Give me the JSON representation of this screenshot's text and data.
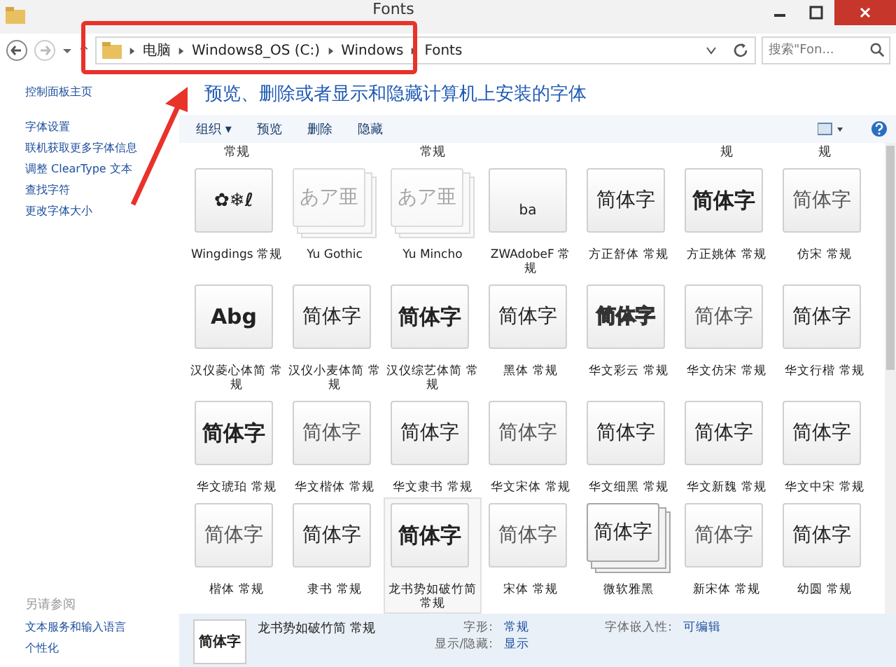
{
  "window": {
    "title": "Fonts"
  },
  "address": {
    "segments": [
      "电脑",
      "Windows8_OS (C:)",
      "Windows",
      "Fonts"
    ],
    "search_placeholder": "搜索\"Fon..."
  },
  "sidebar": {
    "home": "控制面板主页",
    "links": [
      "字体设置",
      "联机获取更多字体信息",
      "调整 ClearType 文本",
      "查找字符",
      "更改字体大小"
    ],
    "see_also_title": "另请参阅",
    "see_also": [
      "文本服务和输入语言",
      "个性化"
    ]
  },
  "heading": "预览、删除或者显示和隐藏计算机上安装的字体",
  "toolbar": {
    "organize": "组织 ▾",
    "buttons": [
      "预览",
      "删除",
      "隐藏"
    ]
  },
  "top_row": [
    {
      "kind": "label",
      "label": "常规"
    },
    {
      "kind": "blank"
    },
    {
      "kind": "label",
      "label": "常规"
    },
    {
      "kind": "blank"
    },
    {
      "kind": "blank"
    },
    {
      "kind": "label",
      "label": "规"
    },
    {
      "kind": "label",
      "label": "规"
    }
  ],
  "fonts": [
    {
      "preview": "✿❄ℓ",
      "kind": "symbol",
      "name": "Wingdings 常规",
      "hidden": false,
      "stacked": false,
      "selected": false
    },
    {
      "preview": "あア亜",
      "kind": "sans",
      "name": "Yu Gothic",
      "hidden": true,
      "stacked": true,
      "selected": false
    },
    {
      "preview": "あア亜",
      "kind": "serif",
      "name": "Yu Mincho",
      "hidden": true,
      "stacked": true,
      "selected": false
    },
    {
      "preview": "ba",
      "kind": "small",
      "name": "ZWAdobeF 常规",
      "hidden": false,
      "stacked": false,
      "selected": false
    },
    {
      "preview": "简体字",
      "kind": "serif",
      "name": "方正舒体 常规",
      "hidden": false,
      "stacked": false,
      "selected": false
    },
    {
      "preview": "简体字",
      "kind": "bold",
      "name": "方正姚体 常规",
      "hidden": false,
      "stacked": false,
      "selected": false
    },
    {
      "preview": "简体字",
      "kind": "light",
      "name": "仿宋 常规",
      "hidden": false,
      "stacked": false,
      "selected": false
    },
    {
      "preview": "Abg",
      "kind": "bold",
      "name": "汉仪菱心体简 常规",
      "hidden": false,
      "stacked": false,
      "selected": false
    },
    {
      "preview": "简体字",
      "kind": "serif",
      "name": "汉仪小麦体简 常规",
      "hidden": false,
      "stacked": false,
      "selected": false
    },
    {
      "preview": "简体字",
      "kind": "bold",
      "name": "汉仪综艺体简 常规",
      "hidden": false,
      "stacked": false,
      "selected": false
    },
    {
      "preview": "简体字",
      "kind": "sans",
      "name": "黑体 常规",
      "hidden": false,
      "stacked": false,
      "selected": false
    },
    {
      "preview": "简体字",
      "kind": "outline",
      "name": "华文彩云 常规",
      "hidden": false,
      "stacked": false,
      "selected": false
    },
    {
      "preview": "简体字",
      "kind": "light",
      "name": "华文仿宋 常规",
      "hidden": false,
      "stacked": false,
      "selected": false
    },
    {
      "preview": "简体字",
      "kind": "serif",
      "name": "华文行楷 常规",
      "hidden": false,
      "stacked": false,
      "selected": false
    },
    {
      "preview": "简体字",
      "kind": "bold",
      "name": "华文琥珀 常规",
      "hidden": false,
      "stacked": false,
      "selected": false
    },
    {
      "preview": "简体字",
      "kind": "light",
      "name": "华文楷体 常规",
      "hidden": false,
      "stacked": false,
      "selected": false
    },
    {
      "preview": "简体字",
      "kind": "serif",
      "name": "华文隶书 常规",
      "hidden": false,
      "stacked": false,
      "selected": false
    },
    {
      "preview": "简体字",
      "kind": "light",
      "name": "华文宋体 常规",
      "hidden": false,
      "stacked": false,
      "selected": false
    },
    {
      "preview": "简体字",
      "kind": "sans",
      "name": "华文细黑 常规",
      "hidden": false,
      "stacked": false,
      "selected": false
    },
    {
      "preview": "简体字",
      "kind": "serif",
      "name": "华文新魏 常规",
      "hidden": false,
      "stacked": false,
      "selected": false
    },
    {
      "preview": "简体字",
      "kind": "sans",
      "name": "华文中宋 常规",
      "hidden": false,
      "stacked": false,
      "selected": false
    },
    {
      "preview": "简体字",
      "kind": "light",
      "name": "楷体 常规",
      "hidden": false,
      "stacked": false,
      "selected": false
    },
    {
      "preview": "简体字",
      "kind": "serif",
      "name": "隶书 常规",
      "hidden": false,
      "stacked": false,
      "selected": false
    },
    {
      "preview": "简体字",
      "kind": "bold",
      "name": "龙书势如破竹简常规",
      "hidden": false,
      "stacked": false,
      "selected": true
    },
    {
      "preview": "简体字",
      "kind": "light",
      "name": "宋体 常规",
      "hidden": false,
      "stacked": false,
      "selected": false
    },
    {
      "preview": "简体字",
      "kind": "sans",
      "name": "微软雅黑",
      "hidden": false,
      "stacked": true,
      "selected": false
    },
    {
      "preview": "简体字",
      "kind": "light",
      "name": "新宋体 常规",
      "hidden": false,
      "stacked": false,
      "selected": false
    },
    {
      "preview": "简体字",
      "kind": "sans",
      "name": "幼圆 常规",
      "hidden": false,
      "stacked": false,
      "selected": false
    }
  ],
  "details": {
    "preview": "简体字",
    "name": "龙书势如破竹简 常规",
    "fields": [
      {
        "label": "字形:",
        "value": "常规"
      },
      {
        "label": "显示/隐藏:",
        "value": "显示"
      }
    ],
    "embed_label": "字体嵌入性:",
    "embed_value": "可编辑"
  }
}
